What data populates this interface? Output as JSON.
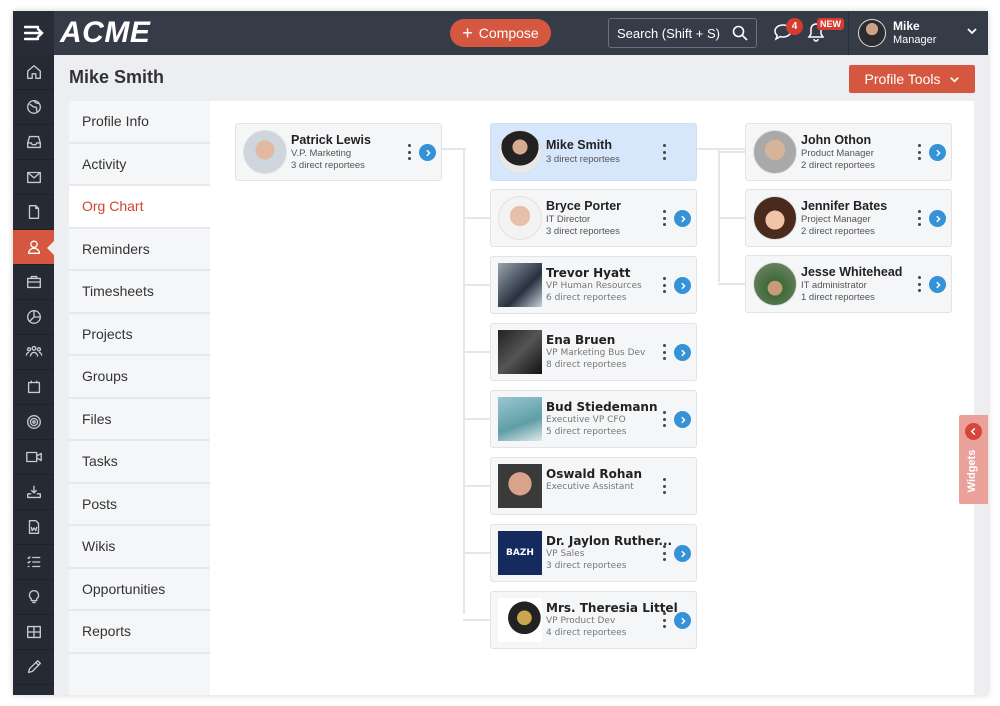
{
  "app": {
    "logo": "ACME"
  },
  "topbar": {
    "compose_label": "Compose",
    "search_placeholder": "Search (Shift + S)",
    "chat_badge": "4",
    "notification_badge": "NEW",
    "user": {
      "name": "Mike",
      "role": "Manager"
    }
  },
  "sidebar": {
    "icons": [
      "home-icon",
      "globe-icon",
      "inbox-icon",
      "mail-icon",
      "document-icon",
      "user-icon",
      "briefcase-icon",
      "pie-chart-icon",
      "group-icon",
      "calendar-icon",
      "target-icon",
      "video-icon",
      "download-icon",
      "word-doc-icon",
      "checklist-icon",
      "lightbulb-icon",
      "grid-icon",
      "pencil-icon"
    ],
    "active": "user-icon"
  },
  "page": {
    "title": "Mike Smith",
    "profile_tools_label": "Profile Tools"
  },
  "tabs": {
    "items": [
      "Profile Info",
      "Activity",
      "Org Chart",
      "Reminders",
      "Timesheets",
      "Projects",
      "Groups",
      "Files",
      "Tasks",
      "Posts",
      "Wikis",
      "Opportunities",
      "Reports"
    ],
    "active": "Org Chart"
  },
  "org": {
    "manager": {
      "name": "Patrick Lewis",
      "role": "V.P. Marketing",
      "reportees": "3 direct reportees"
    },
    "self": {
      "name": "Mike Smith",
      "reportees": "3 direct reportees"
    },
    "colleagues": [
      {
        "name": "Bryce Porter",
        "role": "IT Director",
        "reportees": "3 direct reportees"
      },
      {
        "name": "Trevor Hyatt",
        "role": "VP Human Resources",
        "reportees": "6 direct reportees"
      },
      {
        "name": "Ena Bruen",
        "role": "VP Marketing Bus Dev",
        "reportees": "8 direct reportees"
      },
      {
        "name": "Bud Stiedemann",
        "role": "Executive VP CFO",
        "reportees": "5 direct reportees"
      },
      {
        "name": "Oswald Rohan",
        "role": "Executive Assistant",
        "reportees": ""
      },
      {
        "name": "Dr. Jaylon Ruther...",
        "role": "VP Sales",
        "reportees": "3 direct reportees",
        "logo_text": "BAZH"
      },
      {
        "name": "Mrs. Theresia Littel",
        "role": "VP Product Dev",
        "reportees": "4 direct reportees"
      }
    ],
    "reports": [
      {
        "name": "John Othon",
        "role": "Product Manager",
        "reportees": "2 direct reportees"
      },
      {
        "name": "Jennifer Bates",
        "role": "Project Manager",
        "reportees": "2 direct reportees"
      },
      {
        "name": "Jesse Whitehead",
        "role": "IT administrator",
        "reportees": "1 direct reportees"
      }
    ]
  },
  "widgets": {
    "label": "Widgets"
  },
  "colors": {
    "accent": "#d6573f",
    "topbar": "#363b48",
    "sidebar": "#262a34",
    "link_blue": "#3592d6",
    "selected_card": "#d6e6fb"
  }
}
